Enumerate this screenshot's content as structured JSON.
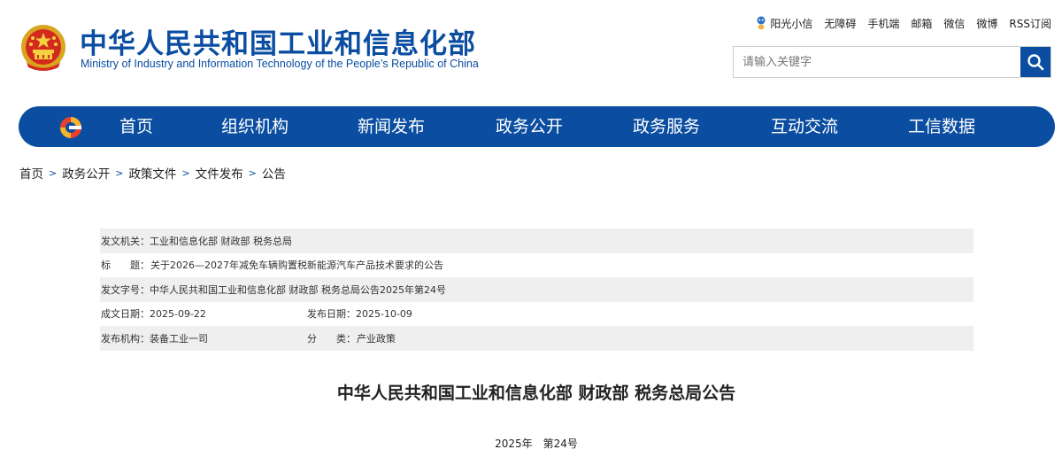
{
  "header": {
    "title_cn": "中华人民共和国工业和信息化部",
    "title_en": "Ministry of Industry and Information Technology of the People’s Republic of China",
    "emblem_icon": "national-emblem-icon"
  },
  "toplinks": [
    "阳光小信",
    "无障碍",
    "手机端",
    "邮箱",
    "微信",
    "微博",
    "RSS订阅"
  ],
  "search": {
    "placeholder": "请输入关键字",
    "value": "",
    "icon": "search-icon"
  },
  "nav": {
    "logo_icon": "miit-logo-icon",
    "items": [
      "首页",
      "组织机构",
      "新闻发布",
      "政务公开",
      "政务服务",
      "互动交流",
      "工信数据"
    ]
  },
  "breadcrumb": [
    "首页",
    "政务公开",
    "政策文件",
    "文件发布",
    "公告"
  ],
  "breadcrumb_separator": ">",
  "info": {
    "issuer_label": "发文机关：",
    "issuer": "工业和信息化部 财政部 税务总局",
    "title_label_a": "标",
    "title_label_b": "题：",
    "title": "关于2026—2027年减免车辆购置税新能源汽车产品技术要求的公告",
    "docno_label": "发文字号：",
    "docno": "中华人民共和国工业和信息化部 财政部 税务总局公告2025年第24号",
    "created_label": "成文日期：",
    "created": "2025-09-22",
    "published_label": "发布日期：",
    "published": "2025-10-09",
    "agency_label": "发布机构：",
    "agency": "装备工业一司",
    "category_label_a": "分",
    "category_label_b": "类：",
    "category": "产业政策"
  },
  "document": {
    "title": "中华人民共和国工业和信息化部 财政部 税务总局公告",
    "number": "2025年　第24号"
  },
  "colors": {
    "brand_blue": "#0a4da1",
    "row_shade": "#efefef"
  }
}
